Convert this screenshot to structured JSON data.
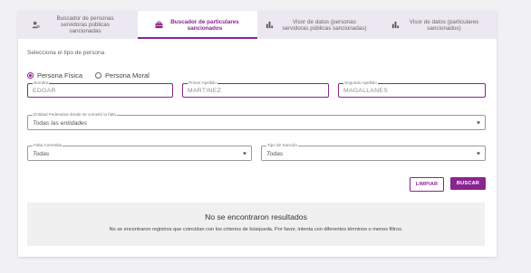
{
  "tabs": [
    {
      "label": "Buscador de personas servidoras públicas sancionadas",
      "icon": "person-search-icon",
      "active": false
    },
    {
      "label": "Buscador de particulares sancionados",
      "icon": "briefcase-icon",
      "active": true
    },
    {
      "label": "Visor de datos (personas servidoras públicas sancionadas)",
      "icon": "bar-chart-icon",
      "active": false
    },
    {
      "label": "Visor de datos (particulares sancionados)",
      "icon": "bar-chart-icon",
      "active": false
    }
  ],
  "form": {
    "type_label": "Selecciona el tipo de persona",
    "radios": [
      {
        "label": "Persona Física",
        "checked": true
      },
      {
        "label": "Persona Moral",
        "checked": false
      }
    ],
    "nombre": {
      "label": "Nombre",
      "value": "EDGAR"
    },
    "primer_apellido": {
      "label": "Primer Apellido",
      "value": "MARTINEZ"
    },
    "segundo_apellido": {
      "label": "Segundo Apellido",
      "value": "MAGALLANES"
    },
    "entidad": {
      "label": "Entidad Federativa donde se cometió la falta",
      "value": "Todas las entidades"
    },
    "falta": {
      "label": "Falta Cometida",
      "value": "Todas"
    },
    "sancion": {
      "label": "Tipo de Sanción",
      "value": "Todas"
    }
  },
  "buttons": {
    "clear": "LIMPIAR",
    "search": "BUSCAR"
  },
  "results": {
    "title": "No se encontraron resultados",
    "description": "No se encontraron registros que coincidan con los criterios de búsqueda. Por favor, intenta con diferentes términos o menos filtros."
  },
  "colors": {
    "accent": "#8a2491"
  }
}
